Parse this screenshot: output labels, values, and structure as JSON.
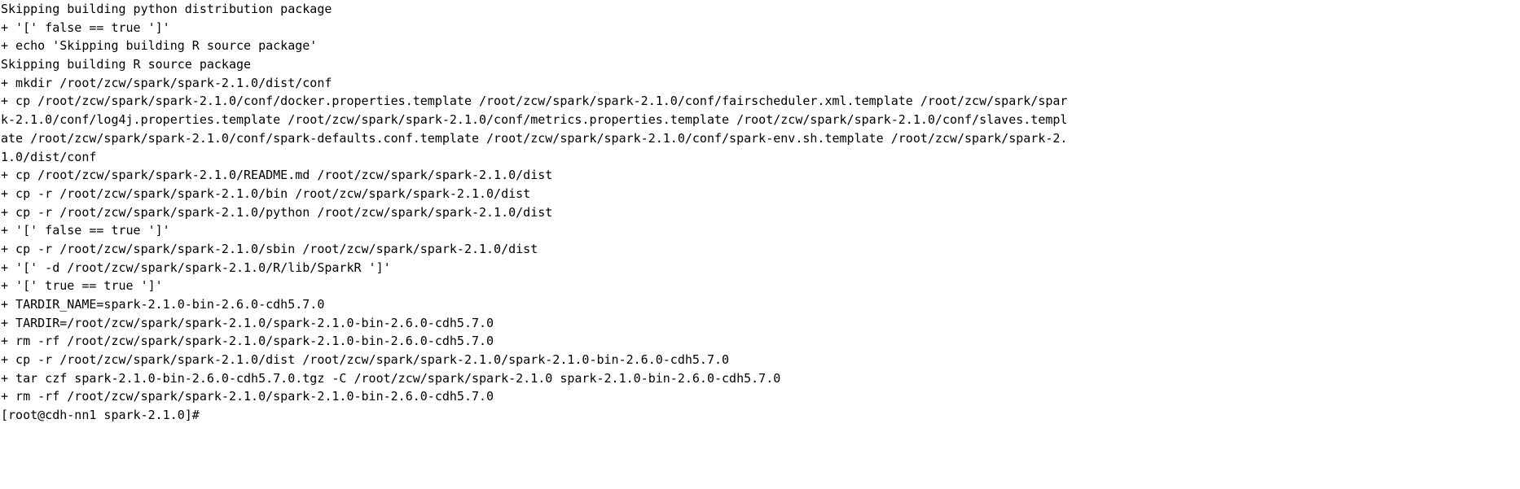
{
  "terminal": {
    "type": "console-output",
    "background_color": "#ffffff",
    "foreground_color": "#000000",
    "font_size_px": 15,
    "line_height_px": 22.7,
    "columns": 203,
    "shell_prompt": "[root@cdh-nn1 spark-2.1.0]#",
    "hostname": "cdh-nn1",
    "user": "root",
    "cwd_basename": "spark-2.1.0",
    "lines": [
      "Skipping building python distribution package",
      "+ '[' false == true ']'",
      "+ echo 'Skipping building R source package'",
      "Skipping building R source package",
      "+ mkdir /root/zcw/spark/spark-2.1.0/dist/conf",
      "+ cp /root/zcw/spark/spark-2.1.0/conf/docker.properties.template /root/zcw/spark/spark-2.1.0/conf/fairscheduler.xml.template /root/zcw/spark/spar",
      "k-2.1.0/conf/log4j.properties.template /root/zcw/spark/spark-2.1.0/conf/metrics.properties.template /root/zcw/spark/spark-2.1.0/conf/slaves.templ",
      "ate /root/zcw/spark/spark-2.1.0/conf/spark-defaults.conf.template /root/zcw/spark/spark-2.1.0/conf/spark-env.sh.template /root/zcw/spark/spark-2.",
      "1.0/dist/conf",
      "+ cp /root/zcw/spark/spark-2.1.0/README.md /root/zcw/spark/spark-2.1.0/dist",
      "+ cp -r /root/zcw/spark/spark-2.1.0/bin /root/zcw/spark/spark-2.1.0/dist",
      "+ cp -r /root/zcw/spark/spark-2.1.0/python /root/zcw/spark/spark-2.1.0/dist",
      "+ '[' false == true ']'",
      "+ cp -r /root/zcw/spark/spark-2.1.0/sbin /root/zcw/spark/spark-2.1.0/dist",
      "+ '[' -d /root/zcw/spark/spark-2.1.0/R/lib/SparkR ']'",
      "+ '[' true == true ']'",
      "+ TARDIR_NAME=spark-2.1.0-bin-2.6.0-cdh5.7.0",
      "+ TARDIR=/root/zcw/spark/spark-2.1.0/spark-2.1.0-bin-2.6.0-cdh5.7.0",
      "+ rm -rf /root/zcw/spark/spark-2.1.0/spark-2.1.0-bin-2.6.0-cdh5.7.0",
      "+ cp -r /root/zcw/spark/spark-2.1.0/dist /root/zcw/spark/spark-2.1.0/spark-2.1.0-bin-2.6.0-cdh5.7.0",
      "+ tar czf spark-2.1.0-bin-2.6.0-cdh5.7.0.tgz -C /root/zcw/spark/spark-2.1.0 spark-2.1.0-bin-2.6.0-cdh5.7.0",
      "+ rm -rf /root/zcw/spark/spark-2.1.0/spark-2.1.0-bin-2.6.0-cdh5.7.0",
      "[root@cdh-nn1 spark-2.1.0]#"
    ]
  }
}
